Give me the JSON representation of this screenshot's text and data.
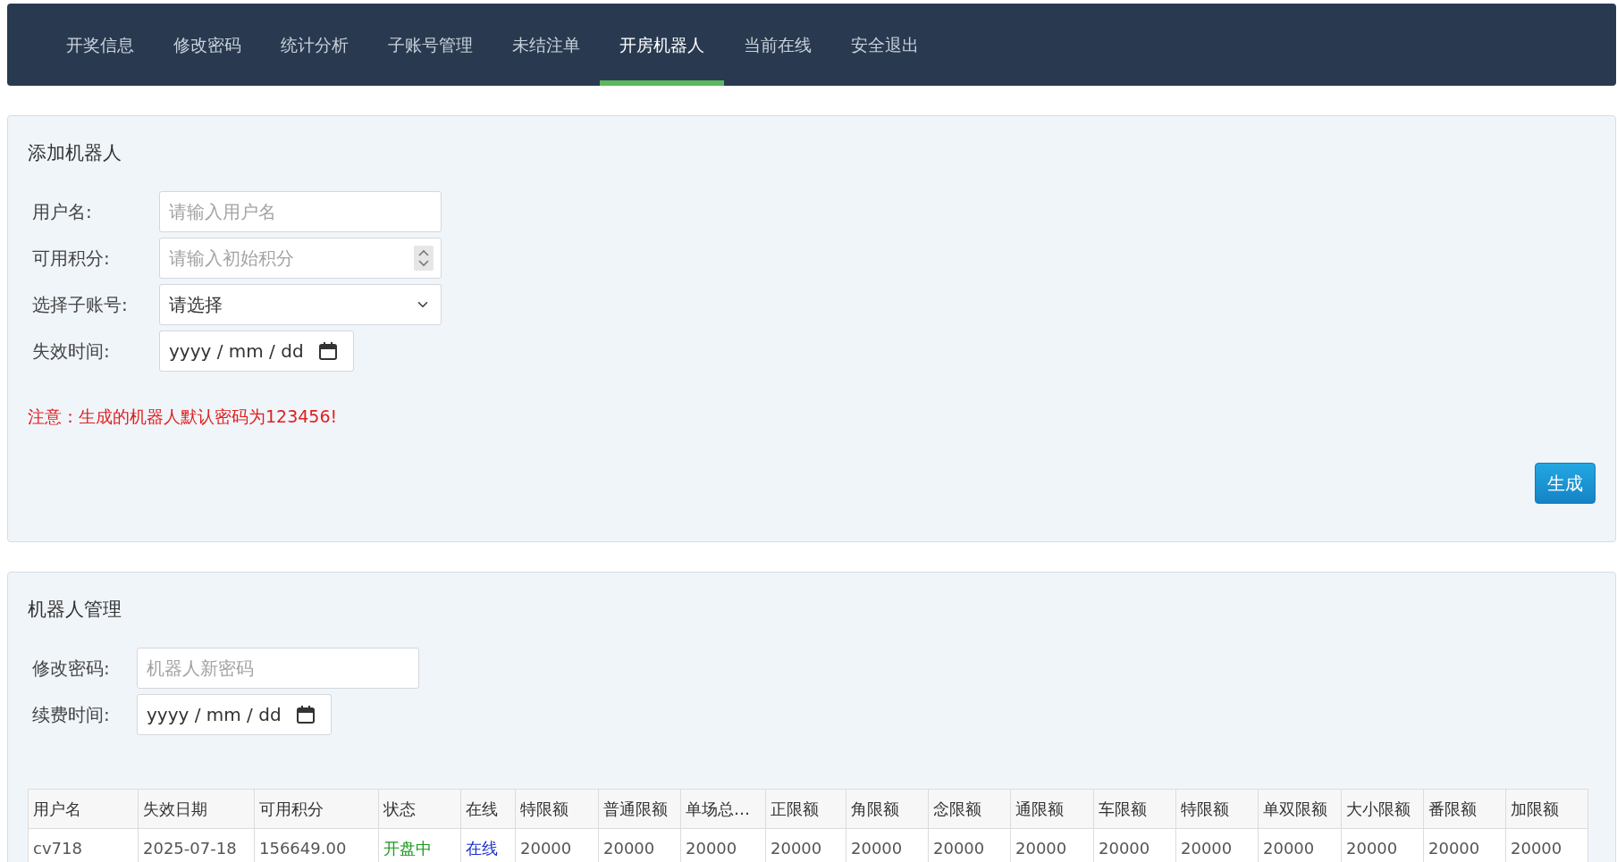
{
  "nav": {
    "tabs": [
      {
        "label": "开奖信息",
        "selected": false
      },
      {
        "label": "修改密码",
        "selected": false
      },
      {
        "label": "统计分析",
        "selected": false
      },
      {
        "label": "子账号管理",
        "selected": false
      },
      {
        "label": "未结注单",
        "selected": false
      },
      {
        "label": "开房机器人",
        "selected": true
      },
      {
        "label": "当前在线",
        "selected": false
      },
      {
        "label": "安全退出",
        "selected": false
      }
    ]
  },
  "add_panel": {
    "title": "添加机器人",
    "fields": [
      {
        "kind": "text",
        "label": "用户名:",
        "placeholder": "请输入用户名"
      },
      {
        "kind": "number",
        "label": "可用积分:",
        "placeholder": "请输入初始积分"
      },
      {
        "kind": "select",
        "label": "选择子账号:",
        "value": "请选择"
      },
      {
        "kind": "date",
        "label": "失效时间:",
        "value": "yyyy / mm / dd"
      }
    ],
    "notice": "注意：生成的机器人默认密码为123456!",
    "button": "生成"
  },
  "manage_panel": {
    "title": "机器人管理",
    "fields": [
      {
        "kind": "text",
        "label": "修改密码:",
        "placeholder": "机器人新密码"
      },
      {
        "kind": "date",
        "label": "续费时间:",
        "value": "yyyy / mm / dd"
      }
    ],
    "table": {
      "columns": [
        {
          "label": "用户名"
        },
        {
          "label": "失效日期"
        },
        {
          "label": "可用积分"
        },
        {
          "label": "状态",
          "kind": "status"
        },
        {
          "label": "在线",
          "kind": "online"
        },
        {
          "label": "特限额"
        },
        {
          "label": "普通限额"
        },
        {
          "label": "单场总…"
        },
        {
          "label": "正限额"
        },
        {
          "label": "角限额"
        },
        {
          "label": "念限额"
        },
        {
          "label": "通限额"
        },
        {
          "label": "车限额"
        },
        {
          "label": "特限额"
        },
        {
          "label": "单双限额"
        },
        {
          "label": "大小限额"
        },
        {
          "label": "番限额"
        },
        {
          "label": "加限额"
        }
      ],
      "rows": [
        [
          "cv718",
          "2025-07-18",
          "156649.00",
          "开盘中",
          "在线",
          "20000",
          "20000",
          "20000",
          "20000",
          "20000",
          "20000",
          "20000",
          "20000",
          "20000",
          "20000",
          "20000",
          "20000",
          "20000"
        ]
      ]
    }
  }
}
